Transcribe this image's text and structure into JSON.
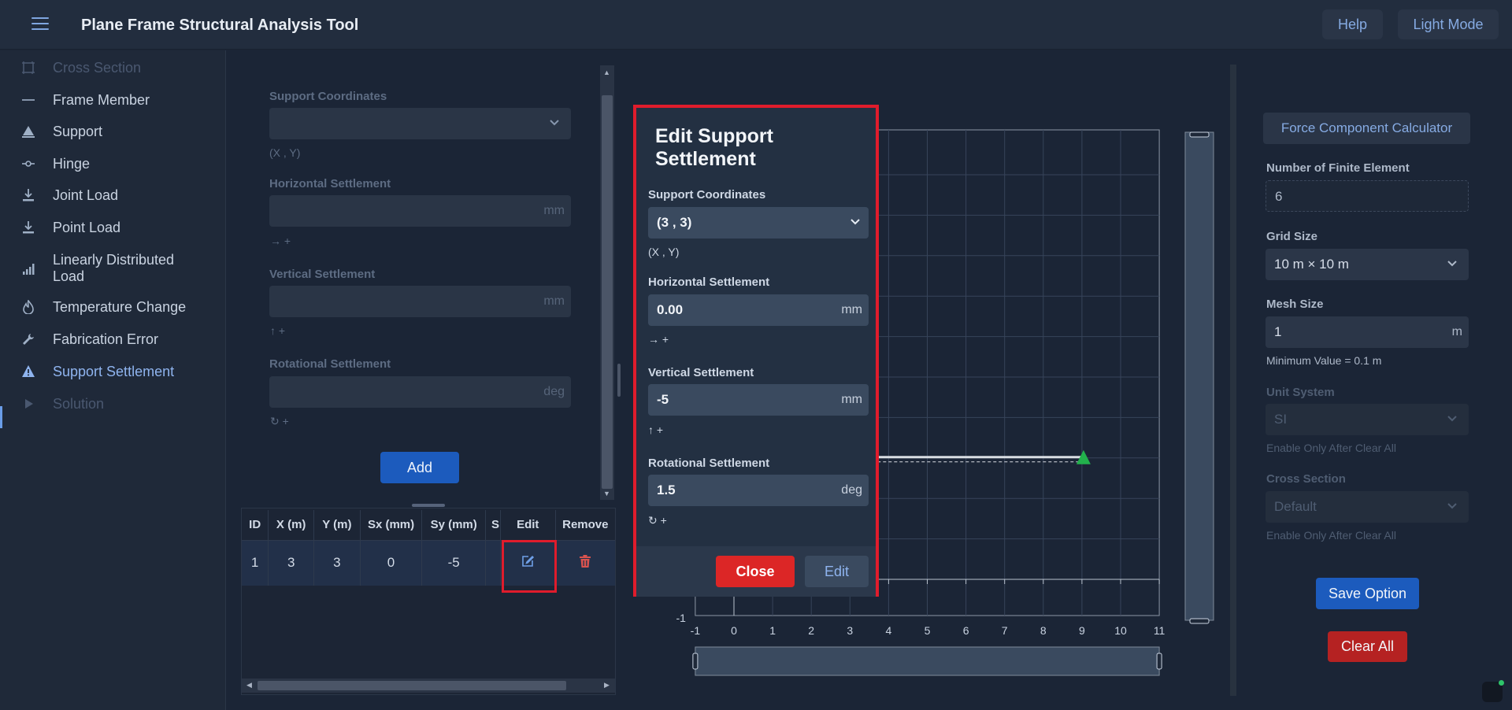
{
  "header": {
    "title": "Plane Frame Structural Analysis Tool",
    "help_label": "Help",
    "mode_label": "Light Mode"
  },
  "sidebar": {
    "items": [
      {
        "label": "Cross Section",
        "icon": "crop-icon",
        "state": "disabled"
      },
      {
        "label": "Frame Member",
        "icon": "line-icon",
        "state": "normal"
      },
      {
        "label": "Support",
        "icon": "triangle-support-icon",
        "state": "normal"
      },
      {
        "label": "Hinge",
        "icon": "hinge-icon",
        "state": "normal"
      },
      {
        "label": "Joint Load",
        "icon": "download-arrow-icon",
        "state": "normal"
      },
      {
        "label": "Point Load",
        "icon": "download-arrow-icon",
        "state": "normal"
      },
      {
        "label": "Linearly Distributed",
        "label2": "Load",
        "icon": "bar-chart-icon",
        "state": "normal"
      },
      {
        "label": "Temperature Change",
        "icon": "flame-icon",
        "state": "normal"
      },
      {
        "label": "Fabrication Error",
        "icon": "wrench-icon",
        "state": "normal"
      },
      {
        "label": "Support Settlement",
        "icon": "warning-triangle-icon",
        "state": "active"
      },
      {
        "label": "Solution",
        "icon": "play-icon",
        "state": "disabled"
      }
    ]
  },
  "form": {
    "coords_label": "Support Coordinates",
    "coords_hint": "(X , Y)",
    "h_label": "Horizontal Settlement",
    "h_unit": "mm",
    "h_hint": "→ +",
    "v_label": "Vertical Settlement",
    "v_unit": "mm",
    "v_hint": "↑ +",
    "r_label": "Rotational Settlement",
    "r_unit": "deg",
    "r_hint": "↻ +",
    "add_label": "Add"
  },
  "table": {
    "headers": [
      "ID",
      "X (m)",
      "Y (m)",
      "Sx (mm)",
      "Sy (mm)",
      "S",
      "Edit",
      "Remove"
    ],
    "rows": [
      {
        "id": "1",
        "x": "3",
        "y": "3",
        "sx": "0",
        "sy": "-5"
      }
    ]
  },
  "modal": {
    "title": "Edit Support Settlement",
    "coords_label": "Support Coordinates",
    "coords_value": "(3 , 3)",
    "coords_hint": "(X , Y)",
    "h_label": "Horizontal Settlement",
    "h_value": "0.00",
    "h_unit": "mm",
    "h_hint": "→ +",
    "v_label": "Vertical Settlement",
    "v_value": "-5",
    "v_unit": "mm",
    "v_hint": "↑ +",
    "r_label": "Rotational Settlement",
    "r_value": "1.5",
    "r_unit": "deg",
    "r_hint": "↻ +",
    "close_label": "Close",
    "edit_label": "Edit"
  },
  "canvas": {
    "x_ticks": [
      "-1",
      "0",
      "1",
      "2",
      "3",
      "4",
      "5",
      "6",
      "7",
      "8",
      "9",
      "10",
      "11"
    ],
    "y_tick_bottom": "-1",
    "member": {
      "x1": 3,
      "x2": 9,
      "y": 3
    },
    "support": {
      "x": 9,
      "y": 3
    }
  },
  "right_panel": {
    "force_calc_label": "Force Component Calculator",
    "fe_label": "Number of Finite Element",
    "fe_value": "6",
    "grid_label": "Grid Size",
    "grid_value": "10 m × 10 m",
    "mesh_label": "Mesh Size",
    "mesh_value": "1",
    "mesh_unit": "m",
    "mesh_hint": "Minimum Value = 0.1 m",
    "unit_label": "Unit System",
    "unit_value": "SI",
    "unit_hint": "Enable Only After Clear All",
    "cs_label": "Cross Section",
    "cs_value": "Default",
    "cs_hint": "Enable Only After Clear All",
    "save_label": "Save Option",
    "clear_label": "Clear All"
  },
  "colors": {
    "accent": "#1c5bbd",
    "danger": "#d42a2a",
    "highlight": "#e01c2c",
    "support": "#22b14c"
  }
}
